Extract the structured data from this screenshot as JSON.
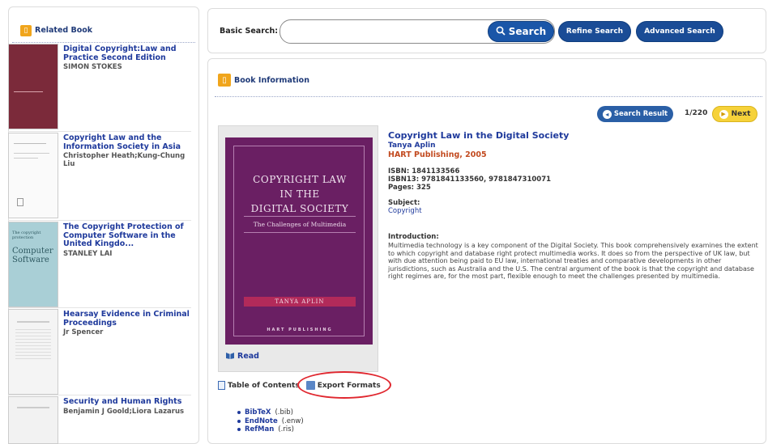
{
  "related": {
    "title": "Related Book",
    "books": [
      {
        "title": "Digital Copyright:Law and Practice Second Edition",
        "author": "SIMON STOKES"
      },
      {
        "title": "Copyright Law and the Information Society in Asia",
        "author": "Christopher Heath;Kung-Chung Liu"
      },
      {
        "title": "The Copyright Protection of Computer Software in the United Kingdo...",
        "author": "STANLEY LAI"
      },
      {
        "title": "Hearsay Evidence in Criminal Proceedings",
        "author": "Jr Spencer"
      },
      {
        "title": "Security and Human Rights",
        "author": "Benjamin J Goold;Liora Lazarus"
      }
    ]
  },
  "search": {
    "label": "Basic Search:",
    "value": "",
    "button": "Search",
    "refine": "Refine Search",
    "advanced": "Advanced Search"
  },
  "info": {
    "title": "Book Information",
    "search_result": "Search Result",
    "pager": "1/220",
    "next": "Next"
  },
  "cover": {
    "title_line1": "COPYRIGHT LAW",
    "title_line2": "IN THE",
    "title_line3": "DIGITAL SOCIETY",
    "subtitle": "The Challenges of Multimedia",
    "author": "TANYA APLIN",
    "publisher": "HART PUBLISHING",
    "read": "Read"
  },
  "book": {
    "title": "Copyright Law in the Digital Society",
    "author": "Tanya Aplin",
    "publisher": "HART Publishing, 2005",
    "isbn": "ISBN: 1841133566",
    "isbn13": "ISBN13: 9781841133560, 9781847310071",
    "pages": "Pages: 325",
    "subject_label": "Subject:",
    "subject": "Copyright",
    "intro_label": "Introduction:",
    "intro": "Multimedia technology is a key component of the Digital Society. This book comprehensively examines the extent to which copyright and database right protect multimedia works. It does so from the perspective of UK law, but with due attention being paid to EU law, international treaties and comparative developments in other jurisdictions, such as Australia and the U.S. The central argument of the book is that the copyright and database right regimes are, for the most part, flexible enough to meet the challenges presented by multimedia."
  },
  "tabs": {
    "toc": "Table of Contents",
    "export": "Export Formats"
  },
  "formats": [
    {
      "name": "BibTeX",
      "ext": "(.bib)"
    },
    {
      "name": "EndNote",
      "ext": "(.enw)"
    },
    {
      "name": "RefMan",
      "ext": "(.ris)"
    }
  ],
  "colors": {
    "brand_blue": "#1a56a8",
    "link_blue": "#1f3a9c",
    "publisher_orange": "#c24a1f",
    "cover_purple": "#6a1f63",
    "highlight_red": "#e0272f",
    "next_yellow": "#f6d23a"
  }
}
